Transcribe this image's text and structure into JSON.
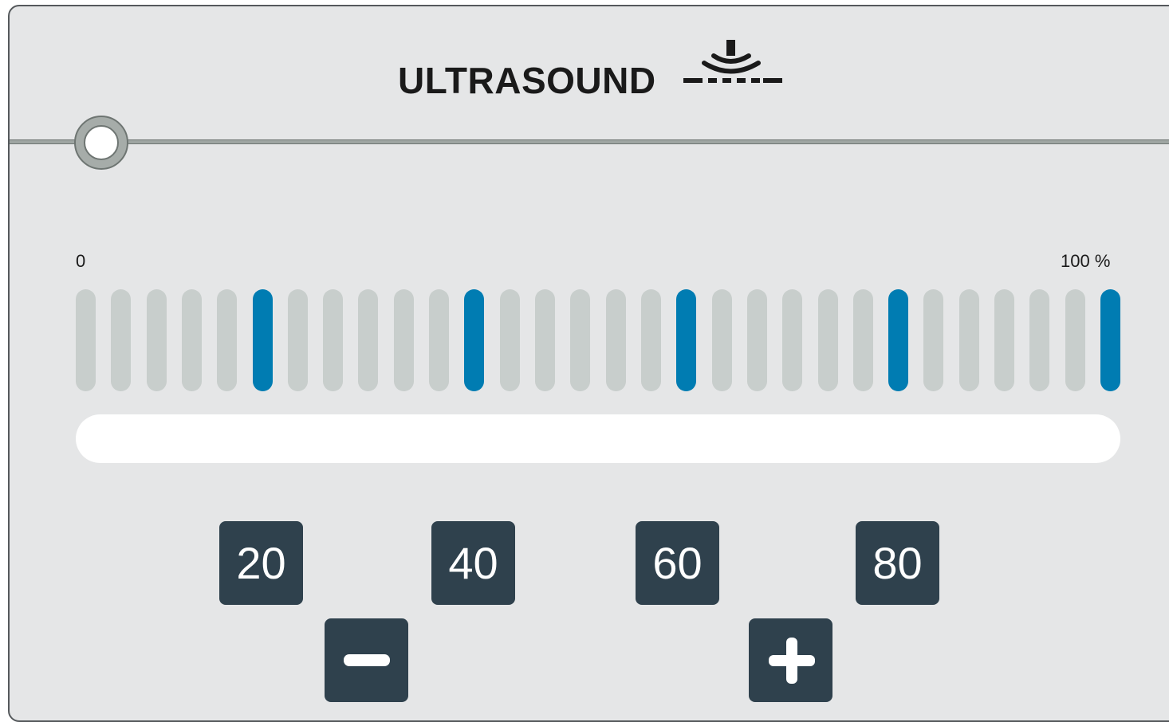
{
  "header": {
    "title": "ULTRASOUND",
    "icon": "ultrasound-transducer-icon"
  },
  "scale": {
    "min_label": "0",
    "max_label": "100 %"
  },
  "level": {
    "bar_count": 30,
    "active_bar_indices": [
      5,
      11,
      17,
      23,
      29
    ],
    "progress": 0
  },
  "presets": [
    "20",
    "40",
    "60",
    "80"
  ],
  "controls": {
    "decrease": "minus-icon",
    "increase": "plus-icon"
  },
  "colors": {
    "panel": "#e5e6e7",
    "button": "#2f414d",
    "accent": "#007cb2",
    "inactive_bar": "#c8cecc"
  }
}
